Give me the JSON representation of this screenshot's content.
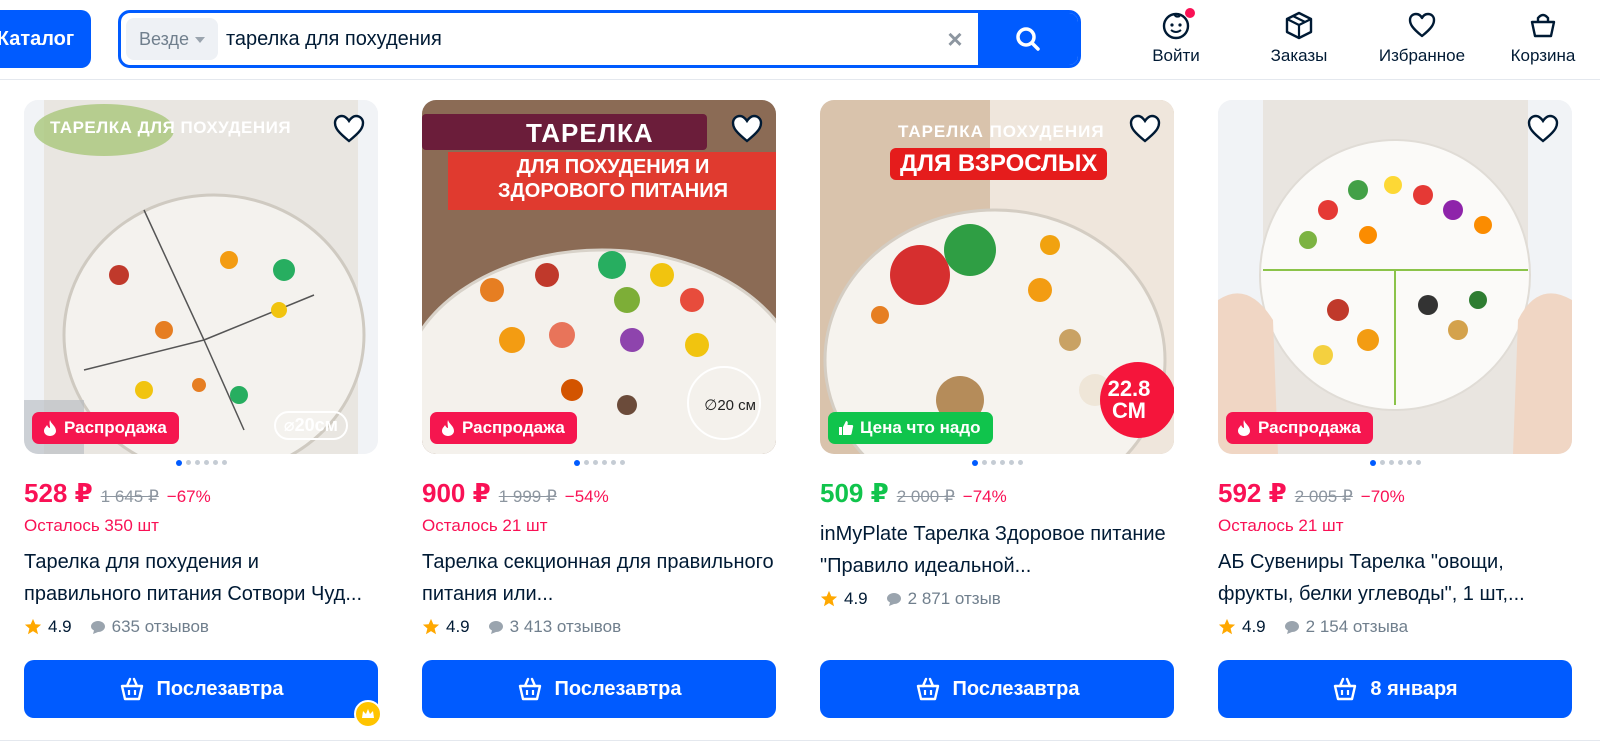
{
  "header": {
    "catalog_label": "Каталог",
    "search_scope": "Везде",
    "search_query": "тарелка для похудения",
    "nav": [
      {
        "label": "Войти",
        "icon": "user-face-icon"
      },
      {
        "label": "Заказы",
        "icon": "box-icon"
      },
      {
        "label": "Избранное",
        "icon": "heart-icon"
      },
      {
        "label": "Корзина",
        "icon": "basket-icon"
      }
    ]
  },
  "colors": {
    "brand": "#005bff",
    "price_red": "#f91155",
    "price_green": "#10c44c",
    "badge_red": "#f5164f",
    "badge_green": "#10c44c"
  },
  "products": [
    {
      "image_caption": "ТАРЕЛКА ДЛЯ ПОХУДЕНИЯ",
      "image_size_note": "⌀20см",
      "badge": "Распродажа",
      "price": "528 ₽",
      "old_price": "1 645 ₽",
      "discount": "−67%",
      "stock": "Осталось 350 шт",
      "title": "Тарелка для похудения и правильного питания Сотвори Чуд...",
      "rating": "4.9",
      "reviews": "635 отзывов",
      "delivery": "Послезавтра"
    },
    {
      "image_caption": "ТАРЕЛКА",
      "image_caption2": "ДЛЯ ПОХУДЕНИЯ И ЗДОРОВОГО ПИТАНИЯ",
      "image_size_note": "∅20 см",
      "badge": "Распродажа",
      "price": "900 ₽",
      "old_price": "1 999 ₽",
      "discount": "−54%",
      "stock": "Осталось 21 шт",
      "title": "Тарелка секционная для правильного питания или...",
      "rating": "4.9",
      "reviews": "3 413 отзывов",
      "delivery": "Послезавтра"
    },
    {
      "image_caption": "ТАРЕЛКА ПОХУДЕНИЯ",
      "image_caption2": "ДЛЯ ВЗРОСЛЫХ",
      "image_size_note": "22.8 СМ",
      "badge": "Цена что надо",
      "price": "509 ₽",
      "old_price": "2 000 ₽",
      "discount": "−74%",
      "title": "inMyPlate Тарелка Здоровое питание \"Правило идеальной...",
      "rating": "4.9",
      "reviews": "2 871 отзыв",
      "delivery": "Послезавтра"
    },
    {
      "badge": "Распродажа",
      "price": "592 ₽",
      "old_price": "2 005 ₽",
      "discount": "−70%",
      "stock": "Осталось 21 шт",
      "title": "АБ Сувениры Тарелка \"овощи, фрукты, белки углеводы\", 1 шт,...",
      "rating": "4.9",
      "reviews": "2 154 отзыва",
      "delivery": "8 января"
    }
  ]
}
